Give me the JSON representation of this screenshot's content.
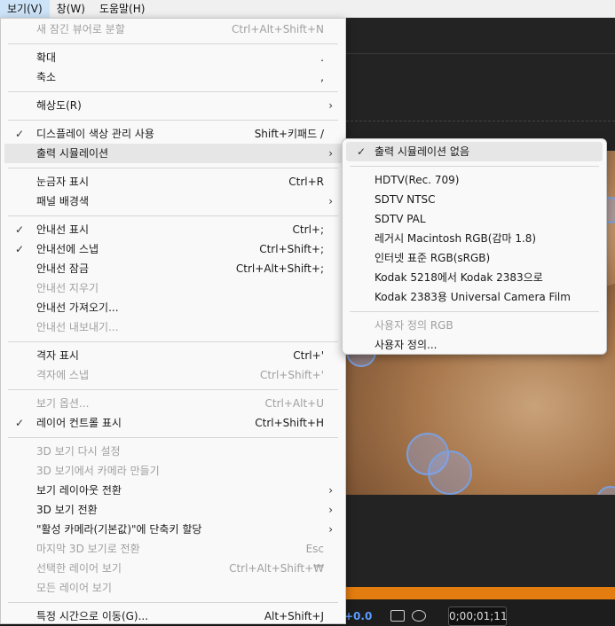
{
  "menubar": {
    "items": [
      {
        "label": "보기(V)",
        "active": true
      },
      {
        "label": "창(W)",
        "active": false
      },
      {
        "label": "도움말(H)",
        "active": false
      }
    ]
  },
  "view_menu": {
    "g1": [
      {
        "label": "새 잠긴 뷰어로 분할",
        "shortcut": "Ctrl+Alt+Shift+N",
        "disabled": true
      }
    ],
    "g2": [
      {
        "label": "확대",
        "shortcut": "."
      },
      {
        "label": "축소",
        "shortcut": ","
      }
    ],
    "g3": [
      {
        "label": "해상도(R)",
        "shortcut": "",
        "submenu": true
      }
    ],
    "g4": [
      {
        "label": "디스플레이 색상 관리 사용",
        "shortcut": "Shift+키패드 /",
        "checked": true
      },
      {
        "label": "출력 시뮬레이션",
        "shortcut": "",
        "submenu": true,
        "highlighted": true
      }
    ],
    "g5": [
      {
        "label": "눈금자 표시",
        "shortcut": "Ctrl+R"
      },
      {
        "label": "패널 배경색",
        "shortcut": "",
        "submenu": true
      }
    ],
    "g6": [
      {
        "label": "안내선 표시",
        "shortcut": "Ctrl+;",
        "checked": true
      },
      {
        "label": "안내선에 스냅",
        "shortcut": "Ctrl+Shift+;",
        "checked": true
      },
      {
        "label": "안내선 잠금",
        "shortcut": "Ctrl+Alt+Shift+;"
      },
      {
        "label": "안내선 지우기",
        "shortcut": "",
        "disabled": true
      },
      {
        "label": "안내선 가져오기...",
        "shortcut": ""
      },
      {
        "label": "안내선 내보내기...",
        "shortcut": "",
        "disabled": true
      }
    ],
    "g7": [
      {
        "label": "격자 표시",
        "shortcut": "Ctrl+'"
      },
      {
        "label": "격자에 스냅",
        "shortcut": "Ctrl+Shift+'",
        "disabled": true
      }
    ],
    "g8": [
      {
        "label": "보기 옵션...",
        "shortcut": "Ctrl+Alt+U",
        "disabled": true
      },
      {
        "label": "레이어 컨트롤 표시",
        "shortcut": "Ctrl+Shift+H",
        "checked": true
      }
    ],
    "g9": [
      {
        "label": "3D 보기 다시 설정",
        "shortcut": "",
        "disabled": true
      },
      {
        "label": "3D 보기에서 카메라 만들기",
        "shortcut": "",
        "disabled": true
      },
      {
        "label": "보기 레이아웃 전환",
        "shortcut": "",
        "submenu": true
      },
      {
        "label": "3D 보기 전환",
        "shortcut": "",
        "submenu": true
      },
      {
        "label": "\"활성 카메라(기본값)\"에 단축키 할당",
        "shortcut": "",
        "submenu": true
      },
      {
        "label": "마지막 3D 보기로 전환",
        "shortcut": "Esc",
        "disabled": true
      },
      {
        "label": "선택한 레이어 보기",
        "shortcut": "Ctrl+Alt+Shift+₩",
        "disabled": true
      },
      {
        "label": "모든 레이어 보기",
        "shortcut": "",
        "disabled": true
      }
    ],
    "g10": [
      {
        "label": "특정 시간으로 이동(G)...",
        "shortcut": "Alt+Shift+J"
      }
    ]
  },
  "output_sim_submenu": {
    "g1": [
      {
        "label": "출력 시뮬레이션 없음",
        "checked": true,
        "highlighted": true
      }
    ],
    "g2": [
      {
        "label": "HDTV(Rec. 709)"
      },
      {
        "label": "SDTV NTSC"
      },
      {
        "label": "SDTV PAL"
      },
      {
        "label": "레거시 Macintosh RGB(감마 1.8)"
      },
      {
        "label": "인터넷 표준 RGB(sRGB)"
      },
      {
        "label": "Kodak 5218에서 Kodak 2383으로"
      },
      {
        "label": "Kodak 2383용 Universal Camera Film"
      }
    ],
    "g3": [
      {
        "label": "사용자 정의 RGB",
        "disabled": true
      },
      {
        "label": "사용자 정의..."
      }
    ]
  },
  "bottom_bar": {
    "value_text": "+0.0",
    "timecode": "0;00;01;11"
  },
  "colors": {
    "timeline_accent": "#e47d10",
    "viewer_bg": "#e9796f",
    "menu_bg": "#f9f9f9",
    "disabled_text": "#a0a0a0"
  }
}
